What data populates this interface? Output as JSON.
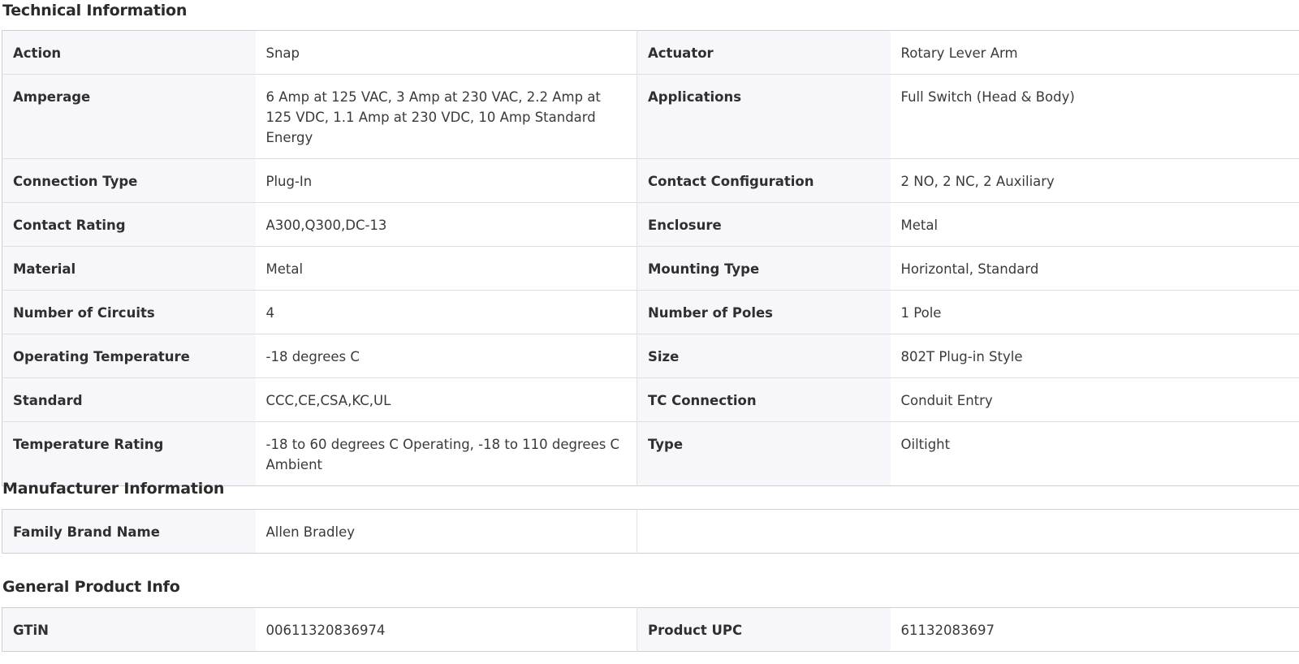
{
  "technical": {
    "title": "Technical Information",
    "rows": [
      {
        "l1": "Action",
        "v1": "Snap",
        "l2": "Actuator",
        "v2": "Rotary Lever Arm"
      },
      {
        "l1": "Amperage",
        "v1": "6 Amp at 125 VAC, 3 Amp at 230 VAC, 2.2 Amp at 125 VDC, 1.1 Amp at 230 VDC, 10 Amp Standard Energy",
        "l2": "Applications",
        "v2": "Full Switch (Head & Body)"
      },
      {
        "l1": "Connection Type",
        "v1": "Plug-In",
        "l2": "Contact Configuration",
        "v2": "2 NO, 2 NC, 2 Auxiliary"
      },
      {
        "l1": "Contact Rating",
        "v1": "A300,Q300,DC-13",
        "l2": "Enclosure",
        "v2": "Metal"
      },
      {
        "l1": "Material",
        "v1": "Metal",
        "l2": "Mounting Type",
        "v2": "Horizontal, Standard"
      },
      {
        "l1": "Number of Circuits",
        "v1": "4",
        "l2": "Number of Poles",
        "v2": "1 Pole"
      },
      {
        "l1": "Operating Temperature",
        "v1": "-18 degrees C",
        "l2": "Size",
        "v2": "802T Plug-in Style"
      },
      {
        "l1": "Standard",
        "v1": "CCC,CE,CSA,KC,UL",
        "l2": "TC Connection",
        "v2": "Conduit Entry"
      },
      {
        "l1": "Temperature Rating",
        "v1": "-18 to 60 degrees C Operating, -18 to 110 degrees C Ambient",
        "l2": "Type",
        "v2": "Oiltight"
      }
    ]
  },
  "manufacturer": {
    "title": "Manufacturer Information",
    "rows": [
      {
        "l1": "Family Brand Name",
        "v1": "Allen Bradley"
      }
    ]
  },
  "general": {
    "title": "General Product Info",
    "rows": [
      {
        "l1": "GTiN",
        "v1": "00611320836974",
        "l2": "Product UPC",
        "v2": "61132083697"
      }
    ]
  }
}
